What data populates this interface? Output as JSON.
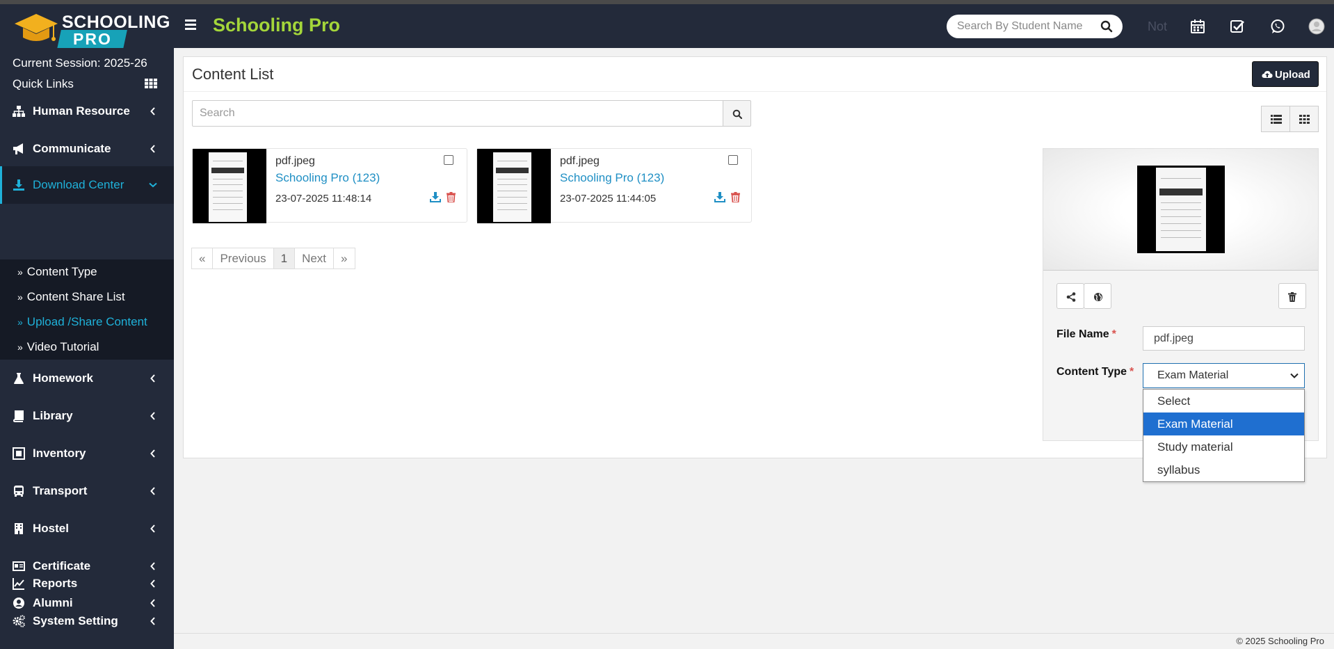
{
  "colors": {
    "header_bg": "#232a3a",
    "brand_green": "#a4d63a",
    "accent_teal": "#1fb1d9",
    "link_blue": "#1f8fc4",
    "danger_red": "#d9534f",
    "select_blue": "#1f6fd0"
  },
  "logo": {
    "line1": "SCHOOLING",
    "line2": "PRO"
  },
  "header": {
    "brand": "Schooling Pro",
    "search_placeholder": "Search By Student Name",
    "notice_text": "Not",
    "icons": [
      "calendar-icon",
      "task-check-icon",
      "whatsapp-icon",
      "user-avatar-icon"
    ]
  },
  "sidebar": {
    "session": "Current Session: 2025-26",
    "quick_links": "Quick Links",
    "items": [
      {
        "label": "Human Resource",
        "icon": "sitemap-icon"
      },
      {
        "label": "Communicate",
        "icon": "bullhorn-icon"
      },
      {
        "label": "Download Center",
        "icon": "download-icon",
        "active": true
      },
      {
        "label": "Homework",
        "icon": "flask-icon"
      },
      {
        "label": "Library",
        "icon": "book-icon"
      },
      {
        "label": "Inventory",
        "icon": "inventory-icon"
      },
      {
        "label": "Transport",
        "icon": "bus-icon"
      },
      {
        "label": "Hostel",
        "icon": "building-icon"
      },
      {
        "label": "Certificate",
        "icon": "certificate-icon"
      },
      {
        "label": "Alumni",
        "icon": "alumni-icon"
      },
      {
        "label": "Reports",
        "icon": "chart-line-icon"
      },
      {
        "label": "System Setting",
        "icon": "gears-icon"
      }
    ],
    "submenu": [
      {
        "label": "Content Type"
      },
      {
        "label": "Content Share List"
      },
      {
        "label": "Upload /Share Content",
        "active": true
      },
      {
        "label": "Video Tutorial"
      }
    ]
  },
  "content": {
    "title": "Content List",
    "upload_label": "Upload",
    "search_placeholder": "Search",
    "cards": [
      {
        "name": "pdf.jpeg",
        "owner": "Schooling Pro (123)",
        "date": "23-07-2025 11:48:14"
      },
      {
        "name": "pdf.jpeg",
        "owner": "Schooling Pro (123)",
        "date": "23-07-2025 11:44:05"
      }
    ],
    "pagination": {
      "first": "«",
      "previous": "Previous",
      "page": "1",
      "next": "Next",
      "last": "»"
    }
  },
  "preview": {
    "file_name_label": "File Name",
    "file_name_value": "pdf.jpeg",
    "content_type_label": "Content Type",
    "content_type_value": "Exam Material",
    "required_mark": "*",
    "options": [
      "Select",
      "Exam Material",
      "Study material",
      "syllabus"
    ],
    "selected_option": "Exam Material"
  },
  "footer": {
    "copyright": "© 2025 Schooling Pro"
  }
}
